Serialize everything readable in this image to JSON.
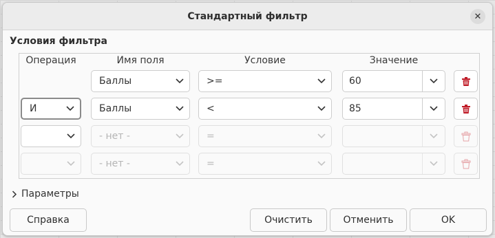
{
  "dialog": {
    "title": "Стандартный фильтр",
    "close_icon": "close-icon"
  },
  "conditions": {
    "section_title": "Условия фильтра",
    "headers": {
      "operation": "Операция",
      "field_name": "Имя поля",
      "condition": "Условие",
      "value": "Значение"
    },
    "rows": [
      {
        "operation": "",
        "field_name": "Баллы",
        "condition": ">=",
        "value": "60",
        "enabled": true
      },
      {
        "operation": "И",
        "field_name": "Баллы",
        "condition": "<",
        "value": "85",
        "enabled": true
      },
      {
        "operation": "",
        "field_name": "- нет -",
        "condition": "=",
        "value": "",
        "enabled": false
      },
      {
        "operation": "",
        "field_name": "- нет -",
        "condition": "=",
        "value": "",
        "enabled": false
      }
    ]
  },
  "options": {
    "parameters_label": "Параметры"
  },
  "buttons": {
    "help": "Справка",
    "clear": "Очистить",
    "cancel": "Отменить",
    "ok": "OK"
  },
  "colors": {
    "delete_icon_active": "#c01c28",
    "delete_icon_disabled": "#e6a4a8"
  }
}
